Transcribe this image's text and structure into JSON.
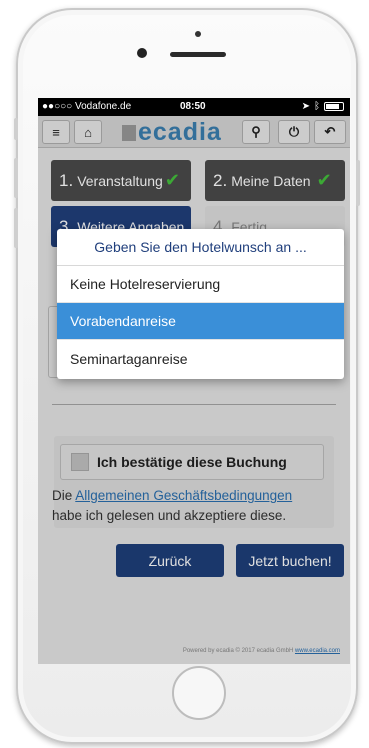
{
  "status_bar": {
    "carrier": "●●○○○ Vodafone.de",
    "time": "08:50"
  },
  "navbar": {
    "menu_icon": "menu-icon",
    "home_icon": "home-icon",
    "logo_text": "ecadia",
    "search_icon": "search-icon",
    "power_icon": "power-icon",
    "back_icon": "back-icon"
  },
  "steps": [
    {
      "num": "1.",
      "label": "Veranstaltung",
      "state": "done"
    },
    {
      "num": "2.",
      "label": "Meine Daten",
      "state": "done"
    },
    {
      "num": "3.",
      "label": "Weitere Angaben",
      "state": "active"
    },
    {
      "num": "4.",
      "label": "Fertig",
      "state": "future"
    }
  ],
  "confirm": {
    "label": "Ich bestätige diese Buchung",
    "text_before": "Die ",
    "link_text": "Allgemeinen Geschäftsbedingungen",
    "text_after": " habe ich gelesen und akzeptiere diese."
  },
  "buttons": {
    "back": "Zurück",
    "book": "Jetzt buchen!"
  },
  "footer": {
    "text": "Powered by ecadia © 2017 ecadia GmbH ",
    "link": "www.ecadia.com"
  },
  "dropdown": {
    "title": "Geben Sie den Hotelwunsch an ...",
    "options": [
      "Keine Hotelreservierung",
      "Vorabendanreise",
      "Seminartaganreise"
    ],
    "selected": "Vorabendanreise"
  },
  "colors": {
    "accent": "#3a8fd8",
    "primary_button": "#1e3f7a",
    "check": "#45c13d"
  }
}
